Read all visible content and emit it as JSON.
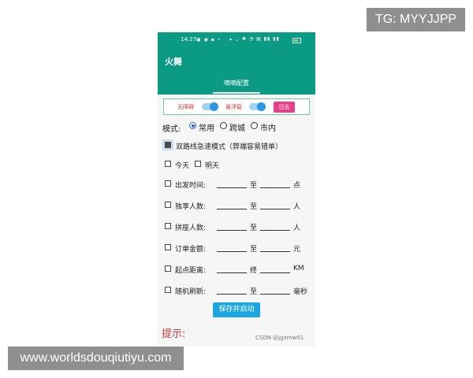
{
  "watermarks": {
    "tg": "TG: MYYJJPP",
    "site": "www.worldsdouqiutiyu.com",
    "csdn": "CSDN @jgxmw01"
  },
  "status_bar": {
    "time": "14:27",
    "left_icons": "▣ ◉ ▪ •",
    "right_icons": "▴ ◡ ✱ ◔ ▤ ▮▮ ▮▮"
  },
  "app": {
    "title": "火舞",
    "tab": "嘀嘀配置"
  },
  "controls": {
    "accessibility_label": "无障碍",
    "accessibility_on": true,
    "floating_label": "悬浮窗",
    "floating_on": true,
    "log_button": "日志"
  },
  "mode": {
    "label": "模式:",
    "options": [
      "常用",
      "跨城",
      "市内"
    ],
    "selected": "常用"
  },
  "dual_route": {
    "label": "双路线急速模式（弊端容易错单）",
    "checked": true
  },
  "days": {
    "today": "今天",
    "tomorrow": "明天"
  },
  "filters": [
    {
      "label": "出发时间:",
      "sep": "至",
      "unit": "点"
    },
    {
      "label": "独享人数:",
      "sep": "至",
      "unit": "人"
    },
    {
      "label": "拼座人数:",
      "sep": "至",
      "unit": "人"
    },
    {
      "label": "订单金额:",
      "sep": "至",
      "unit": "元"
    },
    {
      "label": "起点距离:",
      "sep": "终",
      "unit": "KM"
    },
    {
      "label": "随机刷新:",
      "sep": "至",
      "unit": "毫秒"
    }
  ],
  "save_button": "保存并启动",
  "tip_title": "提示:"
}
